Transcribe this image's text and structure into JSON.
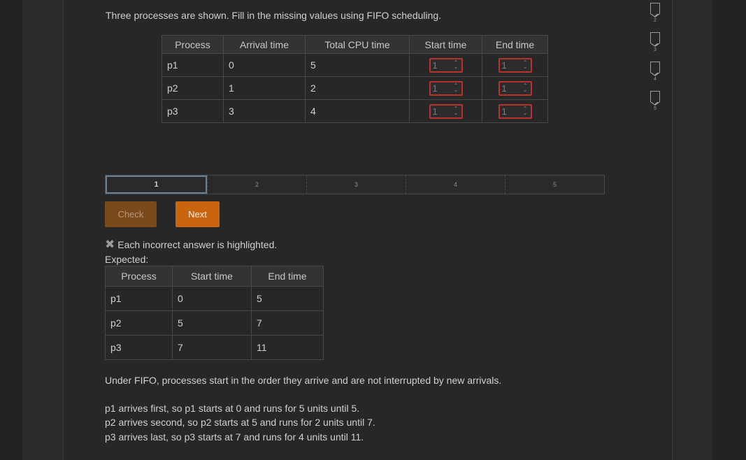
{
  "prompt": "Three processes are shown. Fill in the missing values using FIFO scheduling.",
  "question_table": {
    "headers": [
      "Process",
      "Arrival time",
      "Total CPU time",
      "Start time",
      "End time"
    ],
    "rows": [
      {
        "process": "p1",
        "arrival": "0",
        "cpu": "5",
        "start_input": "1",
        "end_input": "1"
      },
      {
        "process": "p2",
        "arrival": "1",
        "cpu": "2",
        "start_input": "1",
        "end_input": "1"
      },
      {
        "process": "p3",
        "arrival": "3",
        "cpu": "4",
        "start_input": "1",
        "end_input": "1"
      }
    ]
  },
  "progress": {
    "segments": [
      "1",
      "2",
      "3",
      "4",
      "5"
    ],
    "active": "1"
  },
  "buttons": {
    "check": "Check",
    "next": "Next"
  },
  "feedback": {
    "icon": "x-icon",
    "text": "Each incorrect answer is highlighted.",
    "expected_label": "Expected:"
  },
  "expected_table": {
    "headers": [
      "Process",
      "Start time",
      "End time"
    ],
    "rows": [
      {
        "process": "p1",
        "start": "0",
        "end": "5"
      },
      {
        "process": "p2",
        "start": "5",
        "end": "7"
      },
      {
        "process": "p3",
        "start": "7",
        "end": "11"
      }
    ]
  },
  "explanation": {
    "intro": "Under FIFO, processes start in the order they arrive and are not interrupted by new arrivals.",
    "lines": [
      "p1 arrives first, so p1 starts at 0 and runs for 5 units until 5.",
      "p2 arrives second, so p2 starts at 5 and runs for 2 units until 7.",
      "p3 arrives last, so p3 starts at 7 and runs for 4 units until 11."
    ]
  },
  "side_badges": [
    "2",
    "3",
    "4",
    "5"
  ],
  "colors": {
    "accent": "#c9650f",
    "error": "#b8322d",
    "background": "#272727"
  }
}
